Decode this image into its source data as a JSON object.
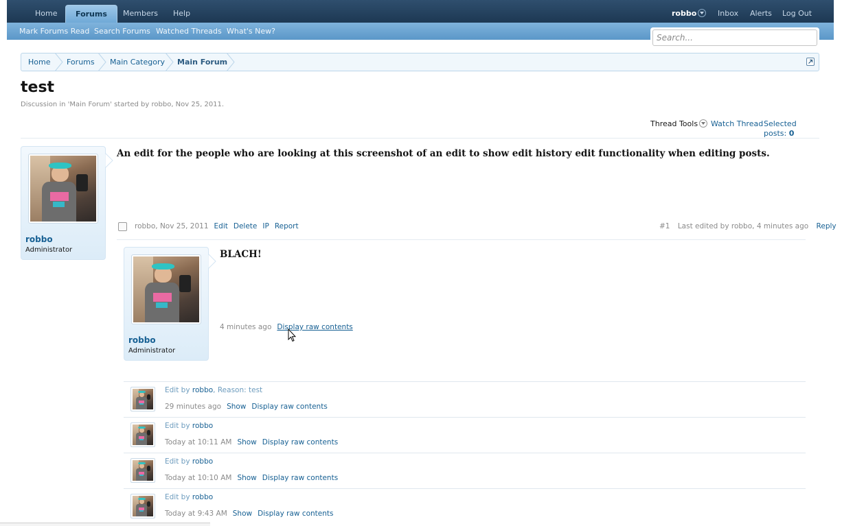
{
  "nav": {
    "tabs": [
      "Home",
      "Forums",
      "Members",
      "Help"
    ],
    "active_tab": "Forums",
    "user": "robbo",
    "inbox": "Inbox",
    "alerts": "Alerts",
    "logout": "Log Out"
  },
  "subnav": {
    "links": [
      "Mark Forums Read",
      "Search Forums",
      "Watched Threads",
      "What's New?"
    ]
  },
  "search": {
    "placeholder": "Search..."
  },
  "breadcrumb": [
    "Home",
    "Forums",
    "Main Category",
    "Main Forum"
  ],
  "thread": {
    "title": "test",
    "description": "Discussion in 'Main Forum' started by robbo, Nov 25, 2011."
  },
  "tools": {
    "thread_tools": "Thread Tools",
    "watch_thread": "Watch Thread",
    "selected_posts_label": "Selected posts:",
    "selected_posts_count": "0"
  },
  "post": {
    "author": "robbo",
    "role": "Administrator",
    "message": "An edit for the people who are looking at this screenshot of an edit to show edit history edit functionality when editing posts.",
    "meta_author_date": "robbo, Nov 25, 2011",
    "actions": [
      "Edit",
      "Delete",
      "IP",
      "Report"
    ],
    "number": "#1",
    "last_edited": "Last edited by robbo, 4 minutes ago",
    "reply": "Reply"
  },
  "edit_preview": {
    "author": "robbo",
    "role": "Administrator",
    "message": "BLACH!",
    "time": "4 minutes ago",
    "raw_link": "Display raw contents"
  },
  "history": [
    {
      "prefix": "Edit by",
      "user": "robbo",
      "reason": ", Reason: test",
      "time": "29 minutes ago",
      "show": "Show",
      "raw": "Display raw contents"
    },
    {
      "prefix": "Edit by",
      "user": "robbo",
      "reason": "",
      "time": "Today at 10:11 AM",
      "show": "Show",
      "raw": "Display raw contents"
    },
    {
      "prefix": "Edit by",
      "user": "robbo",
      "reason": "",
      "time": "Today at 10:10 AM",
      "show": "Show",
      "raw": "Display raw contents"
    },
    {
      "prefix": "Edit by",
      "user": "robbo",
      "reason": "",
      "time": "Today at 9:43 AM",
      "show": "Show",
      "raw": "Display raw contents"
    }
  ]
}
